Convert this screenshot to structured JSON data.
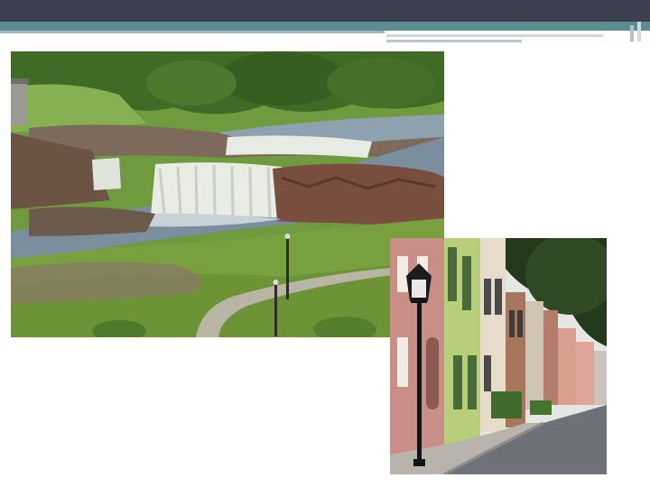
{
  "slide": {
    "header": {
      "dark_color": "#3b3f4e",
      "accent_color": "#5f8d94",
      "line_color": "#9fb7bd"
    },
    "images": [
      {
        "subject": "waterfall-park-photo"
      },
      {
        "subject": "historic-street-photo"
      }
    ]
  }
}
